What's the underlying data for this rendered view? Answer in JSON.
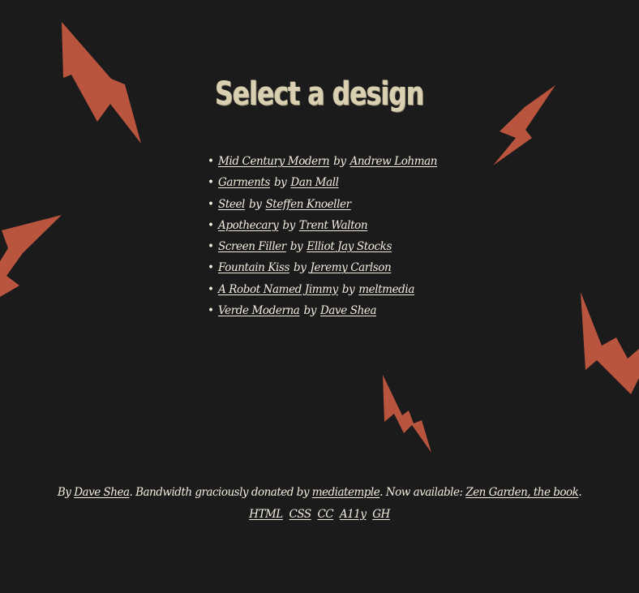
{
  "title": "Select a design",
  "designs": [
    {
      "design": "Mid Century Modern",
      "by": "by",
      "designer": "Andrew Lohman"
    },
    {
      "design": "Garments",
      "by": "by",
      "designer": "Dan Mall"
    },
    {
      "design": "Steel",
      "by": "by",
      "designer": "Steffen Knoeller"
    },
    {
      "design": "Apothecary",
      "by": "by",
      "designer": "Trent Walton"
    },
    {
      "design": "Screen Filler",
      "by": "by",
      "designer": "Elliot Jay Stocks"
    },
    {
      "design": "Fountain Kiss",
      "by": "by",
      "designer": "Jeremy Carlson"
    },
    {
      "design": "A Robot Named Jimmy",
      "by": "by",
      "designer": "meltmedia"
    },
    {
      "design": "Verde Moderna",
      "by": "by",
      "designer": "Dave Shea"
    }
  ],
  "footer": {
    "by_prefix": "By",
    "author": "Dave Shea",
    "bandwidth_text": ". Bandwidth graciously donated by",
    "host": "mediatemple",
    "available_text": ". Now available:",
    "book": "Zen Garden, the book",
    "book_suffix": ".",
    "links": [
      "HTML",
      "CSS",
      "CC",
      "A11y",
      "GH"
    ]
  },
  "colors": {
    "background": "#1c1b1b",
    "bolt": "#b9543e",
    "text": "#f3ece0",
    "title": "#d9cfb1"
  },
  "icons": [
    "lightning-bolt-icon"
  ]
}
